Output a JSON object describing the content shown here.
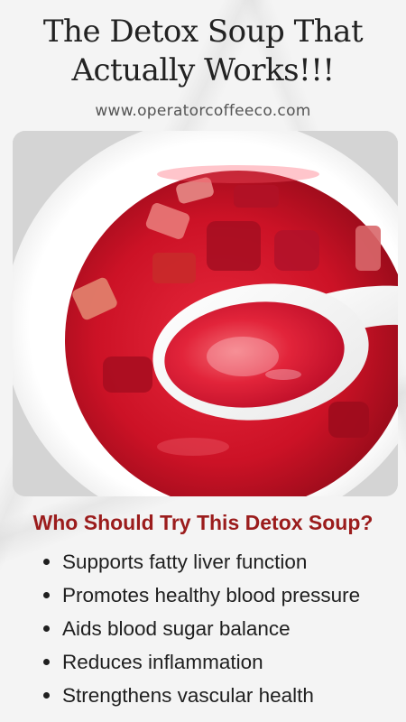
{
  "header": {
    "title_line1": "The Detox Soup That",
    "title_line2": "Actually Works!!!",
    "website": "www.operatorcoffeeco.com"
  },
  "photo": {
    "subject": "red beet detox soup in a white bowl with a spoon",
    "colors": {
      "soup": "#d4152b",
      "bowl": "#f7f7f7",
      "background": "#d9d9d9"
    }
  },
  "benefits": {
    "heading": "Who Should Try This Detox Soup?",
    "heading_color": "#9b1c1c",
    "items": [
      "Supports fatty liver function",
      "Promotes healthy blood pressure",
      "Aids blood sugar balance",
      "Reduces inflammation",
      "Strengthens vascular health"
    ]
  }
}
